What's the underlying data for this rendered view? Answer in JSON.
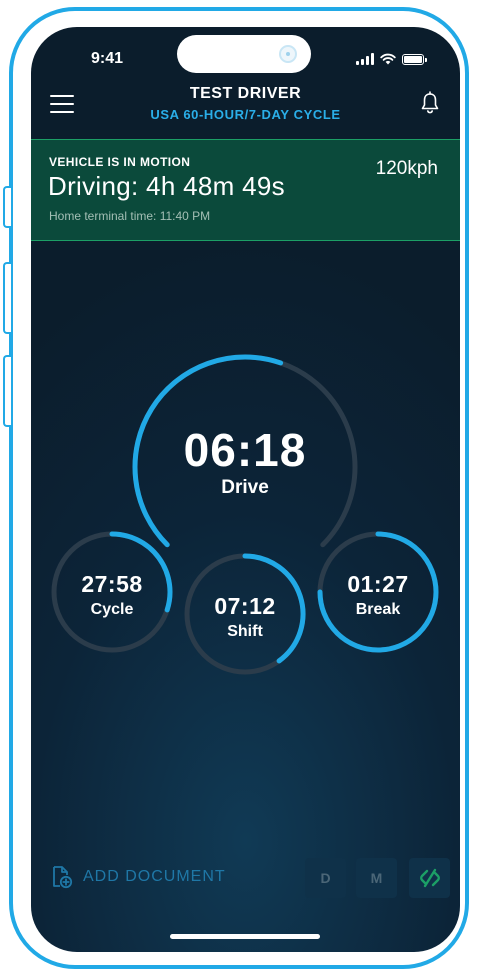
{
  "status_bar": {
    "time": "9:41"
  },
  "header": {
    "menu_icon": "hamburger-menu-icon",
    "driver_name": "TEST DRIVER",
    "cycle": "USA 60-HOUR/7-DAY CYCLE",
    "notifications_icon": "bell-icon"
  },
  "motion_banner": {
    "label": "VEHICLE IS IN MOTION",
    "driving": "Driving: 4h 48m 49s",
    "home_terminal": "Home terminal time: 11:40 PM",
    "speed": "120kph"
  },
  "gauges": {
    "drive": {
      "value": "06:18",
      "label": "Drive",
      "progress": 0.57
    },
    "cycle": {
      "value": "27:58",
      "label": "Cycle",
      "progress": 0.3
    },
    "shift": {
      "value": "07:12",
      "label": "Shift",
      "progress": 0.4
    },
    "break": {
      "value": "01:27",
      "label": "Break",
      "progress": 0.75
    }
  },
  "bottom_bar": {
    "add_document": "ADD DOCUMENT",
    "d_button": "D",
    "m_button": "M",
    "connection_icon": "link-icon"
  },
  "colors": {
    "accent": "#21a9e6",
    "banner_bg": "#0b4a3b",
    "banner_border": "#1c9f66",
    "screen_bg": "#0b1d2c",
    "track": "#2b3c4b"
  }
}
